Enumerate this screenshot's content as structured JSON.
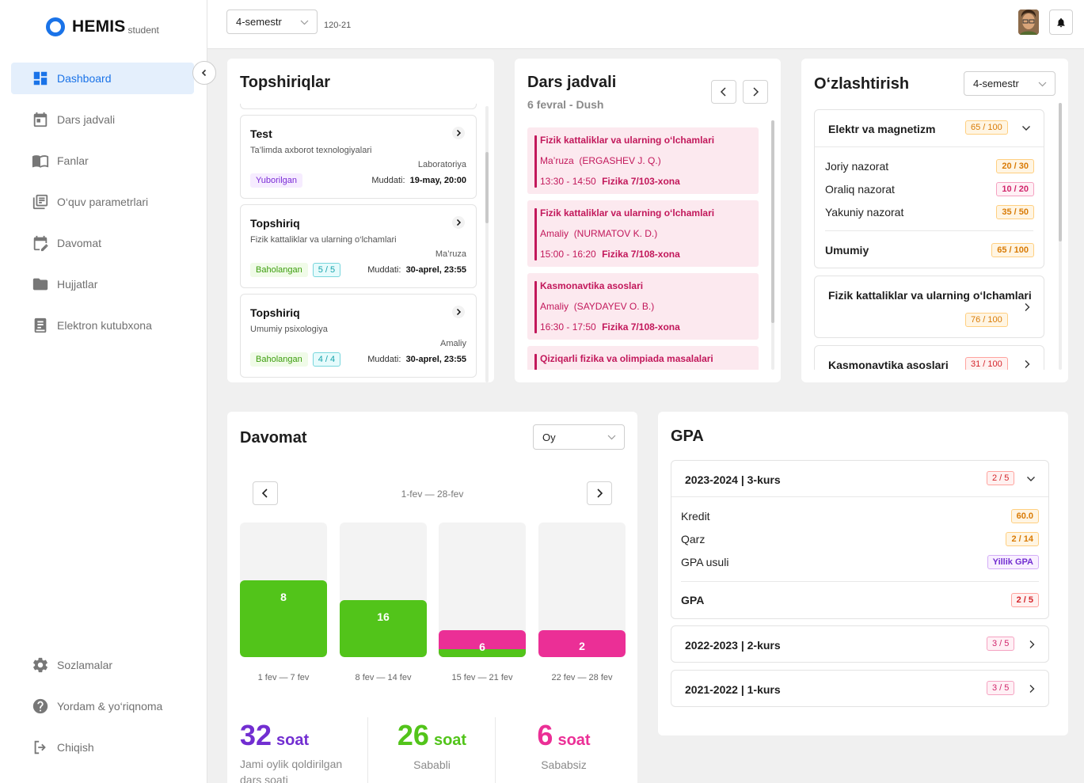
{
  "app": {
    "name": "HEMIS",
    "sub": "student"
  },
  "sidebar": {
    "items": [
      {
        "label": "Dashboard",
        "icon": "dashboard-icon"
      },
      {
        "label": "Dars jadvali",
        "icon": "calendar-icon"
      },
      {
        "label": "Fanlar",
        "icon": "book-icon"
      },
      {
        "label": "O‘quv parametrlari",
        "icon": "library-icon"
      },
      {
        "label": "Davomat",
        "icon": "calendar-edit-icon"
      },
      {
        "label": "Hujjatlar",
        "icon": "folder-icon"
      },
      {
        "label": "Elektron kutubxona",
        "icon": "ebook-icon"
      }
    ],
    "bottom_items": [
      {
        "label": "Sozlamalar",
        "icon": "gear-icon"
      },
      {
        "label": "Yordam & yo‘riqnoma",
        "icon": "help-icon"
      },
      {
        "label": "Chiqish",
        "icon": "logout-icon"
      }
    ]
  },
  "topbar": {
    "semester": "4-semestr",
    "group": "120-21"
  },
  "tasks": {
    "title": "Topshiriqlar",
    "items": [
      {
        "title": "Test",
        "subject": "Ta’limda axborot texnologiyalari",
        "type": "Laboratoriya",
        "status": "Yuborilgan",
        "score": "",
        "deadline_label": "Muddati:",
        "deadline": "19-may, 20:00"
      },
      {
        "title": "Topshiriq",
        "subject": "Fizik kattaliklar va ularning o‘lchamlari",
        "type": "Ma’ruza",
        "status": "Baholangan",
        "score": "5 / 5",
        "deadline_label": "Muddati:",
        "deadline": "30-aprel, 23:55"
      },
      {
        "title": "Topshiriq",
        "subject": "Umumiy psixologiya",
        "type": "Amaliy",
        "status": "Baholangan",
        "score": "4 / 4",
        "deadline_label": "Muddati:",
        "deadline": "30-aprel, 23:55"
      }
    ]
  },
  "schedule": {
    "title": "Dars jadvali",
    "date": "6 fevral - Dush",
    "lessons": [
      {
        "name": "Fizik kattaliklar va ularning o‘lchamlari",
        "type": "Ma’ruza",
        "teacher": "(ERGASHEV J. Q.)",
        "time": "13:30 - 14:50",
        "room": "Fizika 7/103-xona"
      },
      {
        "name": "Fizik kattaliklar va ularning o‘lchamlari",
        "type": "Amaliy",
        "teacher": "(NURMATOV K. D.)",
        "time": "15:00 - 16:20",
        "room": "Fizika 7/108-xona"
      },
      {
        "name": "Kasmonavtika asoslari",
        "type": "Amaliy",
        "teacher": "(SAYDAYEV O. B.)",
        "time": "16:30 - 17:50",
        "room": "Fizika 7/108-xona"
      },
      {
        "name": "Qiziqarli fizika va olimpiada masalalari",
        "type": "",
        "teacher": "",
        "time": "",
        "room": ""
      }
    ]
  },
  "mastery": {
    "title": "O‘zlashtirish",
    "semester": "4-semestr",
    "expanded": {
      "subject": "Elektr va magnetizm",
      "score": "65 / 100",
      "rows": [
        {
          "label": "Joriy nazorat",
          "value": "20 / 30"
        },
        {
          "label": "Oraliq nazorat",
          "value": "10 / 20"
        },
        {
          "label": "Yakuniy nazorat",
          "value": "35 / 50"
        }
      ],
      "total_label": "Umumiy",
      "total": "65 / 100"
    },
    "others": [
      {
        "subject": "Fizik kattaliklar va ularning o‘lchamlari",
        "score": "76 / 100"
      },
      {
        "subject": "Kasmonavtika asoslari",
        "score": "31 / 100"
      }
    ]
  },
  "attendance": {
    "title": "Davomat",
    "period_select": "Oy",
    "range": "1-fev — 28-fev",
    "weeks": [
      {
        "label": "1 fev — 7 fev",
        "value": "8"
      },
      {
        "label": "8 fev — 14 fev",
        "value": "16"
      },
      {
        "label": "15 fev — 21 fev",
        "value": "6"
      },
      {
        "label": "22 fev — 28 fev",
        "value": "2"
      }
    ],
    "totals": [
      {
        "value": "32",
        "unit": "soat",
        "label": "Jami oylik qoldirilgan dars soati"
      },
      {
        "value": "26",
        "unit": "soat",
        "label": "Sababli"
      },
      {
        "value": "6",
        "unit": "soat",
        "label": "Sababsiz"
      }
    ]
  },
  "gpa": {
    "title": "GPA",
    "expanded": {
      "year": "2023-2024 | 3-kurs",
      "score": "2 / 5",
      "rows": [
        {
          "label": "Kredit",
          "value": "60.0"
        },
        {
          "label": "Qarz",
          "value": "2 / 14"
        },
        {
          "label": "GPA usuli",
          "value": "Yillik GPA"
        }
      ],
      "total_label": "GPA",
      "total": "2 / 5"
    },
    "others": [
      {
        "year": "2022-2023 | 2-kurs",
        "score": "3 / 5"
      },
      {
        "year": "2021-2022 | 1-kurs",
        "score": "3 / 5"
      }
    ]
  },
  "colors": {
    "accent": "#1a73e8",
    "green": "#52c41a",
    "pink": "#eb2f96",
    "purple": "#722ed1"
  }
}
